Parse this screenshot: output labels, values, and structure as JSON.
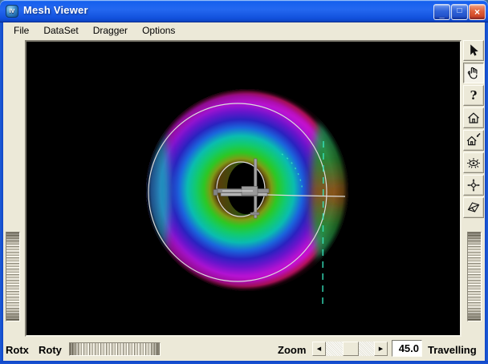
{
  "window": {
    "title": "Mesh Viewer",
    "icon_text": "IV"
  },
  "titlebar": {
    "minimize_glyph": "_",
    "maximize_glyph": "□",
    "close_glyph": "×"
  },
  "menu": {
    "items": [
      "File",
      "DataSet",
      "Dragger",
      "Options"
    ]
  },
  "toolbar": {
    "buttons": [
      {
        "name": "pick-mode",
        "active": false
      },
      {
        "name": "view-pan-hand",
        "active": true
      },
      {
        "name": "help",
        "active": false,
        "glyph": "?"
      },
      {
        "name": "home-view",
        "active": false
      },
      {
        "name": "set-home-view",
        "active": false
      },
      {
        "name": "view-all",
        "active": false
      },
      {
        "name": "seek",
        "active": false
      },
      {
        "name": "camera-type-toggle",
        "active": false
      }
    ]
  },
  "bottom_bar": {
    "rotx_label": "Rotx",
    "roty_label": "Roty",
    "zoom_label": "Zoom",
    "zoom_value": "45.0",
    "mode_label": "Travelling",
    "scroll_left_glyph": "◀",
    "scroll_right_glyph": "▶"
  },
  "scene": {
    "description": "rainbow color-mapped torus mesh with jack dragger and silhouette curves",
    "palette": [
      "#000000",
      "#2a1c06",
      "#6e5e12",
      "#7c9c16",
      "#2cc824",
      "#12ca6e",
      "#0abcb0",
      "#1a66dc",
      "#2a22c0",
      "#6a14cc",
      "#b212d2",
      "#cc10cc",
      "#e61478",
      "#44051a"
    ],
    "band_right": [
      "#22bc92",
      "#1f8c2e",
      "#8a5416",
      "#1f8c2e",
      "#22bc92"
    ],
    "band_left": [
      "#2452cc",
      "#16b6b6"
    ],
    "crescent": [
      "#5a3c0a",
      "#2c5410",
      "#0a1604"
    ],
    "spot_color": "#8a5416",
    "line_color": "#dcdcdc",
    "dash_color": "#38e6c0",
    "dragger_color": "#a2a2a2"
  }
}
